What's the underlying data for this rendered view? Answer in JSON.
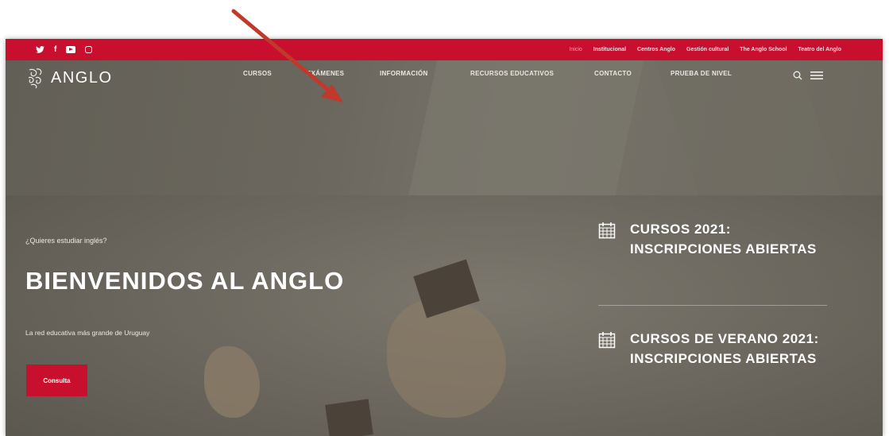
{
  "topbar": {
    "social": [
      "twitter-icon",
      "facebook-icon",
      "youtube-icon",
      "instagram-icon"
    ],
    "links": [
      {
        "label": "Inicio",
        "active": true
      },
      {
        "label": "Institucional"
      },
      {
        "label": "Centros Anglo"
      },
      {
        "label": "Gestión cultural"
      },
      {
        "label": "The Anglo School"
      },
      {
        "label": "Teatro del Anglo"
      }
    ],
    "color": "#c8102e"
  },
  "brand": {
    "name": "ANGLO"
  },
  "nav": {
    "items": [
      {
        "label": "CURSOS"
      },
      {
        "label": "EXÁMENES"
      },
      {
        "label": "INFORMACIÓN"
      },
      {
        "label": "RECURSOS EDUCATIVOS"
      },
      {
        "label": "CONTACTO"
      },
      {
        "label": "PRUEBA DE NIVEL"
      }
    ],
    "tools": [
      "search-icon",
      "hamburger-menu-icon"
    ]
  },
  "hero": {
    "kicker": "¿Quieres estudiar inglés?",
    "headline": "BIENVENIDOS AL ANGLO",
    "tagline": "La red educativa más grande de Uruguay",
    "cta": "Consulta"
  },
  "news": [
    {
      "title": "CURSOS 2021: INSCRIPCIONES ABIERTAS",
      "icon": "calendar-icon"
    },
    {
      "title": "CURSOS DE VERANO 2021: INSCRIPCIONES ABIERTAS",
      "icon": "calendar-icon"
    }
  ],
  "annotation": {
    "arrow_color": "#c0392b"
  }
}
